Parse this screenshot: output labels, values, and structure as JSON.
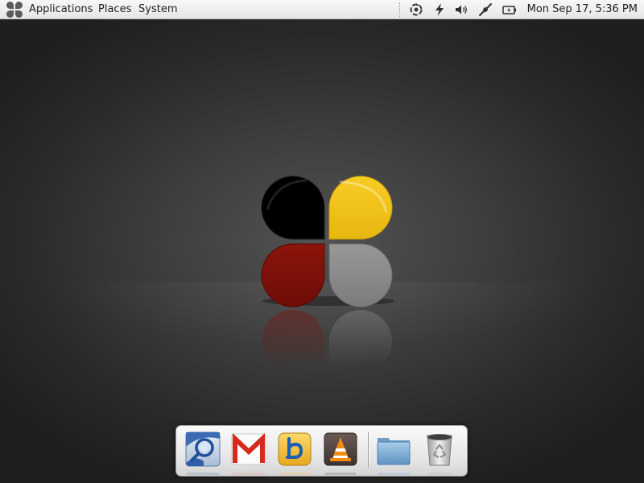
{
  "top_panel": {
    "menus": {
      "applications": "Applications",
      "places": "Places",
      "system": "System"
    },
    "tray_icons": [
      "power-manager-icon",
      "bolt-icon",
      "volume-icon",
      "network-icon",
      "battery-icon"
    ],
    "clock": "Mon Sep 17,  5:36 PM"
  },
  "desktop": {
    "logo_colors": {
      "top_left": "#000000",
      "top_right": "#f2c318",
      "bottom_left": "#7e0f08",
      "bottom_right": "#8a8a8a"
    }
  },
  "dock": {
    "items": [
      "browser-icon",
      "gmail-icon",
      "bible-icon",
      "vlc-icon",
      "folder-icon",
      "trash-icon"
    ]
  }
}
